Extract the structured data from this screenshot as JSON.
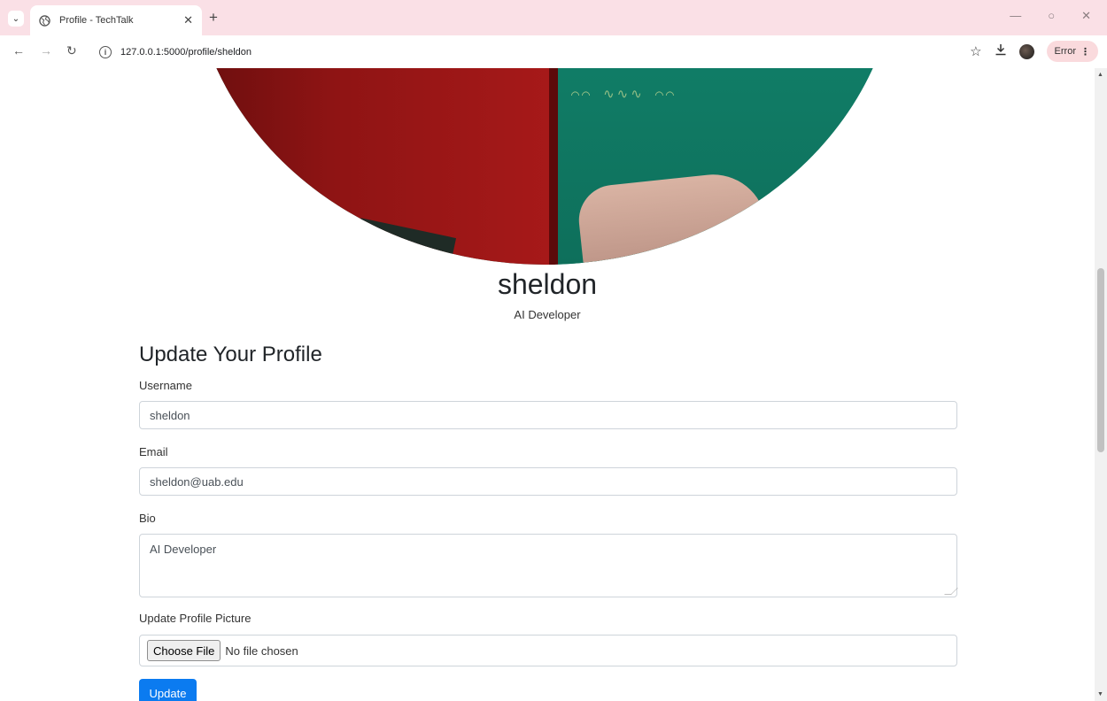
{
  "browser": {
    "tab_title": "Profile - TechTalk",
    "url": "127.0.0.1:5000/profile/sheldon",
    "error_label": "Error"
  },
  "profile": {
    "username": "sheldon",
    "bio": "AI Developer"
  },
  "form": {
    "heading": "Update Your Profile",
    "username_label": "Username",
    "username_value": "sheldon",
    "email_label": "Email",
    "email_value": "sheldon@uab.edu",
    "bio_label": "Bio",
    "bio_value": "AI Developer",
    "picture_label": "Update Profile Picture",
    "file_button": "Choose File",
    "file_status": "No file chosen",
    "submit_label": "Update"
  }
}
